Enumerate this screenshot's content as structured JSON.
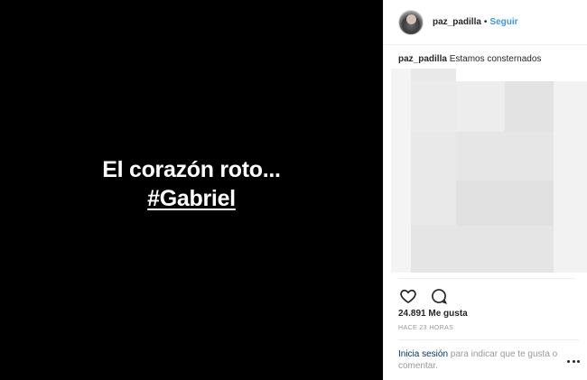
{
  "media": {
    "line1": "El corazón roto...",
    "hashtag": "#Gabriel",
    "background": "#000000",
    "text_color": "#ffffff"
  },
  "post": {
    "username": "paz_padilla",
    "separator": "•",
    "follow_label": "Seguir",
    "caption_user": "paz_padilla",
    "caption_text": "Estamos consternados",
    "likes": "24.891 Me gusta",
    "time": "HACE 23 HORAS"
  },
  "actions": {
    "like_icon": "heart-icon",
    "comment_icon": "comment-icon",
    "more_icon": "more-options-icon"
  },
  "login": {
    "link": "Inicia sesión",
    "text": " para indicar que te gusta o comentar."
  },
  "colors": {
    "link_blue": "#3897f0",
    "login_link": "#003569",
    "muted": "#999999",
    "text": "#262626"
  }
}
